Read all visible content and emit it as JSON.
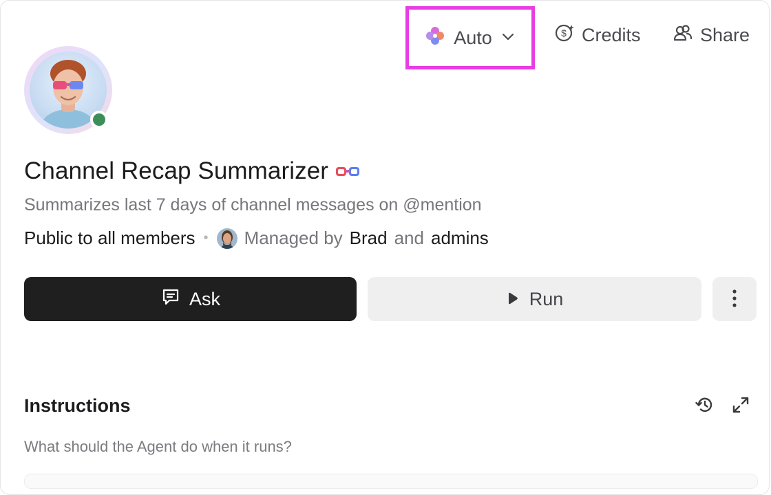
{
  "toolbar": {
    "model_label": "Auto",
    "credits_label": "Credits",
    "share_label": "Share"
  },
  "agent": {
    "title": "Channel Recap Summarizer",
    "description": "Summarizes last 7 days of channel messages on @mention",
    "visibility": "Public to all members",
    "managed_by_prefix": "Managed by",
    "manager_name": "Brad",
    "and_text": "and",
    "admins_text": "admins",
    "status": "online"
  },
  "actions": {
    "ask_label": "Ask",
    "run_label": "Run"
  },
  "instructions": {
    "heading": "Instructions",
    "placeholder": "What should the Agent do when it runs?"
  },
  "colors": {
    "highlight": "#e83de3",
    "primary_button": "#1f1f1f",
    "secondary_button": "#efeff0",
    "online": "#3e8e5a"
  },
  "icons": {
    "model": "sparkle-flower-icon",
    "credits": "credits-coin-icon",
    "share": "share-users-icon",
    "ask": "chat-bubble-icon",
    "run": "play-icon",
    "more": "more-vertical-icon",
    "history": "history-icon",
    "expand": "expand-icon"
  }
}
